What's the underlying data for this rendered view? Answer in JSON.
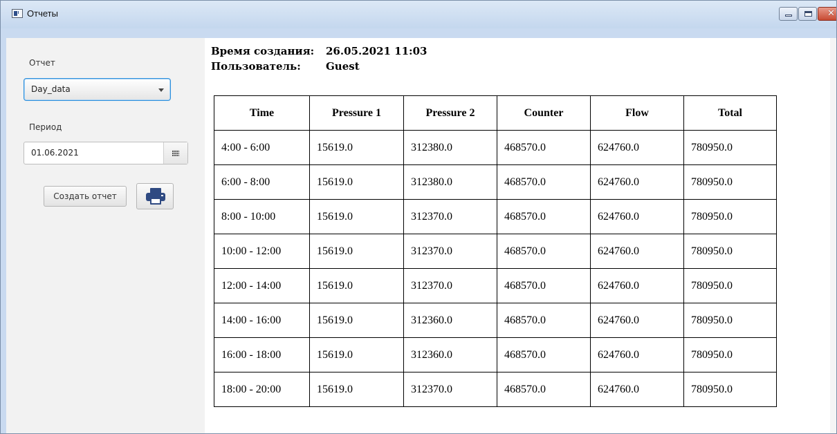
{
  "window": {
    "title": "Отчеты",
    "buttons": {
      "minimize": "",
      "maximize": "",
      "close": "✕"
    }
  },
  "sidebar": {
    "report_label": "Отчет",
    "report_selected": "Day_data",
    "period_label": "Период",
    "period_value": "01.06.2021",
    "create_button": "Создать отчет",
    "print_icon": "printer-icon"
  },
  "report": {
    "created_label": "Время создания:",
    "created_value": "26.05.2021 11:03",
    "user_label": "Пользователь:",
    "user_value": "Guest",
    "columns": [
      "Time",
      "Pressure 1",
      "Pressure 2",
      "Counter",
      "Flow",
      "Total"
    ],
    "rows": [
      [
        "4:00 - 6:00",
        "15619.0",
        "312380.0",
        "468570.0",
        "624760.0",
        "780950.0"
      ],
      [
        "6:00 - 8:00",
        "15619.0",
        "312380.0",
        "468570.0",
        "624760.0",
        "780950.0"
      ],
      [
        "8:00 - 10:00",
        "15619.0",
        "312370.0",
        "468570.0",
        "624760.0",
        "780950.0"
      ],
      [
        "10:00 - 12:00",
        "15619.0",
        "312370.0",
        "468570.0",
        "624760.0",
        "780950.0"
      ],
      [
        "12:00 - 14:00",
        "15619.0",
        "312370.0",
        "468570.0",
        "624760.0",
        "780950.0"
      ],
      [
        "14:00 - 16:00",
        "15619.0",
        "312360.0",
        "468570.0",
        "624760.0",
        "780950.0"
      ],
      [
        "16:00 - 18:00",
        "15619.0",
        "312360.0",
        "468570.0",
        "624760.0",
        "780950.0"
      ],
      [
        "18:00 - 20:00",
        "15619.0",
        "312370.0",
        "468570.0",
        "624760.0",
        "780950.0"
      ]
    ]
  }
}
